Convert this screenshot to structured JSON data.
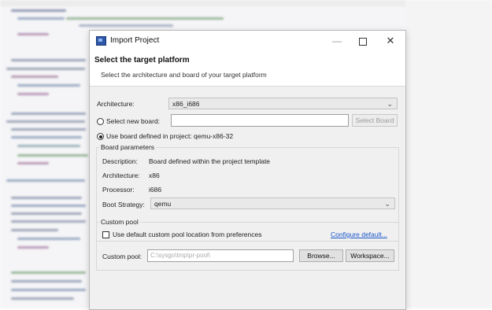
{
  "window": {
    "title": "Import Project",
    "min_symbol": "—",
    "close_symbol": "✕"
  },
  "header": {
    "title": "Select the target platform",
    "subtitle": "Select the architecture and board of your target platform"
  },
  "architecture": {
    "label": "Architecture:",
    "value": "x86_i686"
  },
  "board_selection": {
    "new_board_label": "Select new board:",
    "new_board_value": "",
    "select_board_button": "Select Board",
    "project_board_label": "Use board defined in project: qemu-x86-32"
  },
  "board_parameters": {
    "title": "Board parameters",
    "description_label": "Description:",
    "description_value": "Board defined within the project template",
    "architecture_label": "Architecture:",
    "architecture_value": "x86",
    "processor_label": "Processor:",
    "processor_value": "i686",
    "boot_strategy_label": "Boot Strategy:",
    "boot_strategy_value": "qemu"
  },
  "custom_pool": {
    "title": "Custom pool",
    "default_checkbox_label": "Use default custom pool location from preferences",
    "configure_link": "Configure default...",
    "pool_label": "Custom pool:",
    "pool_value": "C:\\sysgo\\tmp\\pr-pool\\",
    "browse_button": "Browse...",
    "workspace_button": "Workspace..."
  },
  "icons": {
    "chevron": "⌄"
  }
}
